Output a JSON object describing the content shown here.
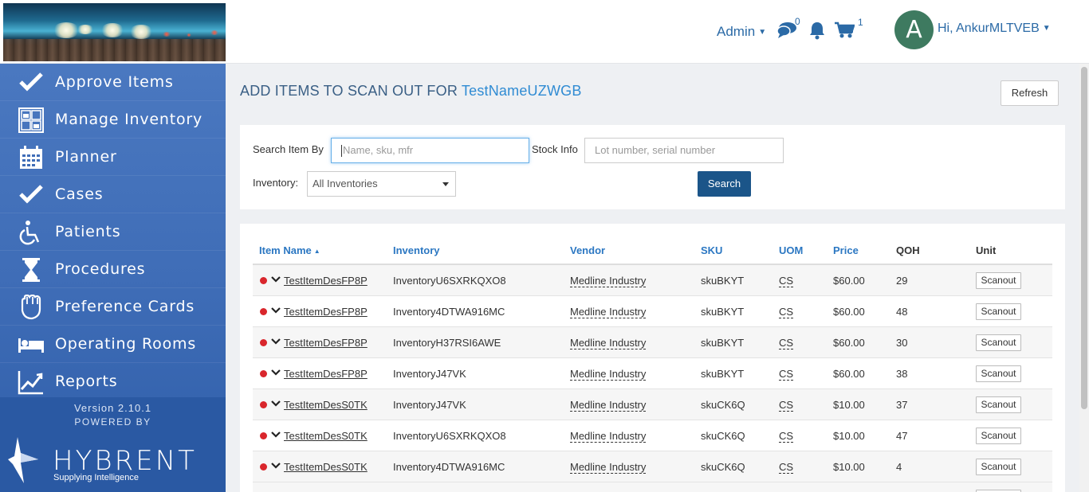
{
  "header": {
    "admin_label": "Admin",
    "messages_count": "0",
    "cart_count": "1",
    "avatar_initial": "A",
    "greeting": "Hi, AnkurMLTVEB"
  },
  "sidebar": {
    "items": [
      {
        "label": "Approve Items",
        "icon": "check-icon"
      },
      {
        "label": "Manage Inventory",
        "icon": "inventory-grid-icon"
      },
      {
        "label": "Planner",
        "icon": "calendar-icon"
      },
      {
        "label": "Cases",
        "icon": "check-icon"
      },
      {
        "label": "Patients",
        "icon": "wheelchair-icon"
      },
      {
        "label": "Procedures",
        "icon": "hourglass-icon"
      },
      {
        "label": "Preference Cards",
        "icon": "glove-icon"
      },
      {
        "label": "Operating Rooms",
        "icon": "bed-icon"
      },
      {
        "label": "Reports",
        "icon": "line-chart-icon"
      }
    ],
    "version": "Version 2.10.1",
    "powered_by": "POWERED BY",
    "brand": "HYBRENT",
    "tagline": "Supplying Intelligence"
  },
  "main": {
    "title_prefix": "ADD ITEMS TO SCAN OUT FOR",
    "title_entity": "TestNameUZWGB",
    "refresh_label": "Refresh"
  },
  "search": {
    "search_item_label": "Search Item By",
    "search_item_placeholder": "Name, sku, mfr",
    "stock_info_label": "Stock Info",
    "stock_info_placeholder": "Lot number, serial number",
    "inventory_label": "Inventory:",
    "inventory_value": "All Inventories",
    "search_button": "Search"
  },
  "table": {
    "columns": [
      "Item Name",
      "Inventory",
      "Vendor",
      "SKU",
      "UOM",
      "Price",
      "QOH",
      "Unit"
    ],
    "scanout_label": "Scanout",
    "rows": [
      {
        "item": "TestItemDesFP8P",
        "inventory": "InventoryU6SXRKQXO8",
        "vendor": "Medline Industry",
        "sku": "skuBKYT",
        "uom": "CS",
        "price": "$60.00",
        "qoh": "29"
      },
      {
        "item": "TestItemDesFP8P",
        "inventory": "Inventory4DTWA916MC",
        "vendor": "Medline Industry",
        "sku": "skuBKYT",
        "uom": "CS",
        "price": "$60.00",
        "qoh": "48"
      },
      {
        "item": "TestItemDesFP8P",
        "inventory": "InventoryH37RSI6AWE",
        "vendor": "Medline Industry",
        "sku": "skuBKYT",
        "uom": "CS",
        "price": "$60.00",
        "qoh": "30"
      },
      {
        "item": "TestItemDesFP8P",
        "inventory": "InventoryJ47VK",
        "vendor": "Medline Industry",
        "sku": "skuBKYT",
        "uom": "CS",
        "price": "$60.00",
        "qoh": "38"
      },
      {
        "item": "TestItemDesS0TK",
        "inventory": "InventoryJ47VK",
        "vendor": "Medline Industry",
        "sku": "skuCK6Q",
        "uom": "CS",
        "price": "$10.00",
        "qoh": "37"
      },
      {
        "item": "TestItemDesS0TK",
        "inventory": "InventoryU6SXRKQXO8",
        "vendor": "Medline Industry",
        "sku": "skuCK6Q",
        "uom": "CS",
        "price": "$10.00",
        "qoh": "47"
      },
      {
        "item": "TestItemDesS0TK",
        "inventory": "Inventory4DTWA916MC",
        "vendor": "Medline Industry",
        "sku": "skuCK6Q",
        "uom": "CS",
        "price": "$10.00",
        "qoh": "4"
      }
    ]
  },
  "colors": {
    "accent": "#2b6aa6",
    "sidebar": "#3f6db7",
    "primary_button": "#1b5589",
    "status_dot": "#d9262c"
  }
}
